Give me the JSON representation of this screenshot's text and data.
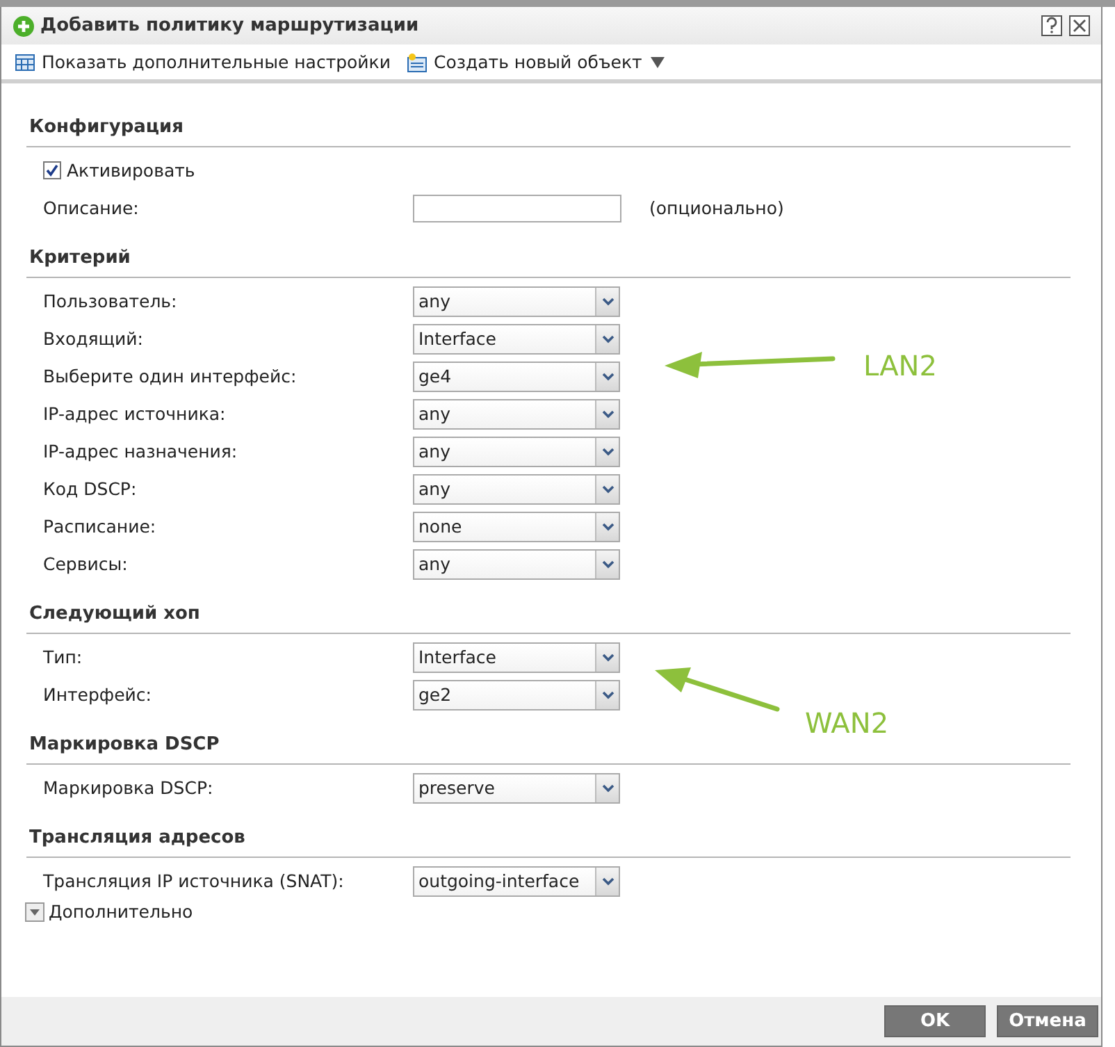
{
  "window": {
    "title": "Добавить политику маршрутизации"
  },
  "toolbar": [
    {
      "kind": "settings",
      "label": "Показать дополнительные настройки"
    },
    {
      "kind": "create",
      "label": "Создать новый объект"
    }
  ],
  "sections": [
    {
      "title": "Конфигурация",
      "fields": [
        {
          "kind": "checkbox",
          "label": "Активировать",
          "checked": true
        },
        {
          "kind": "text",
          "label": "Описание:",
          "note": "(опционально)"
        }
      ]
    },
    {
      "title": "Критерий",
      "fields": [
        {
          "kind": "select",
          "label": "Пользователь:",
          "value": "any"
        },
        {
          "kind": "select",
          "label": "Входящий:",
          "value": "Interface"
        },
        {
          "kind": "select",
          "label": "Выберите один интерфейс:",
          "value": "ge4",
          "annotation": {
            "kind": "left",
            "text": "LAN2"
          }
        },
        {
          "kind": "select",
          "label": "IP-адрес источника:",
          "value": "any"
        },
        {
          "kind": "select",
          "label": "IP-адрес назначения:",
          "value": "any"
        },
        {
          "kind": "select",
          "label": "Код DSCP:",
          "value": "any"
        },
        {
          "kind": "select",
          "label": "Расписание:",
          "value": "none"
        },
        {
          "kind": "select",
          "label": "Сервисы:",
          "value": "any"
        }
      ]
    },
    {
      "title": "Следующий хоп",
      "fields": [
        {
          "kind": "select",
          "label": "Тип:",
          "value": "Interface"
        },
        {
          "kind": "select",
          "label": "Интерфейс:",
          "value": "ge2",
          "annotation": {
            "kind": "up-left",
            "text": "WAN2"
          }
        }
      ]
    },
    {
      "title": "Маркировка DSCP",
      "fields": [
        {
          "kind": "select",
          "label": "Маркировка DSCP:",
          "value": "preserve"
        }
      ]
    },
    {
      "title": "Трансляция адресов",
      "fields": [
        {
          "kind": "select",
          "label": "Трансляция IP источника (SNAT):",
          "value": "outgoing-interface"
        }
      ]
    }
  ],
  "advanced": {
    "label": "Дополнительно",
    "expanded": false
  },
  "buttons": [
    "OK",
    "Отмена"
  ]
}
